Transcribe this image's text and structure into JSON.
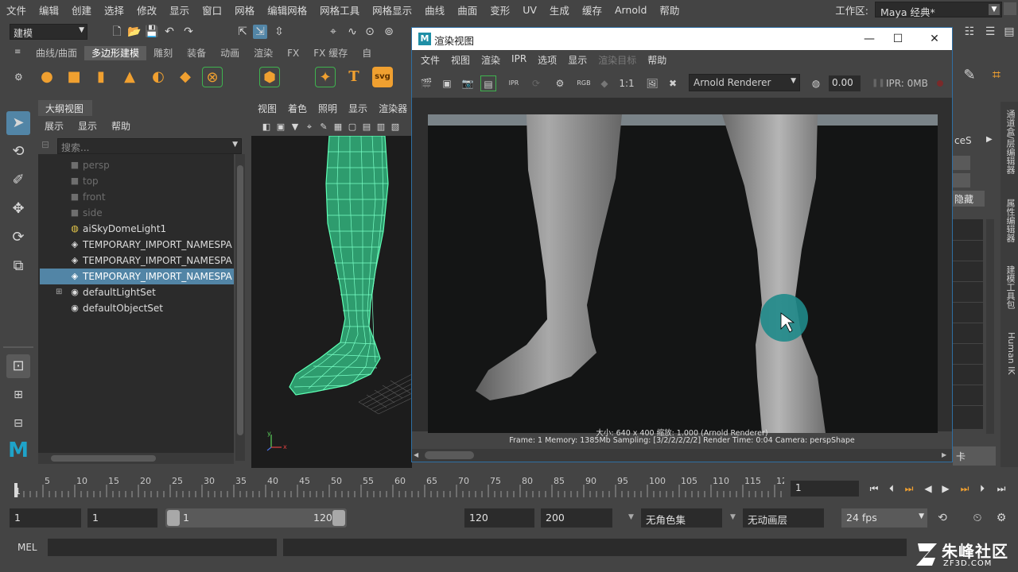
{
  "menubar": {
    "items": [
      "文件",
      "编辑",
      "创建",
      "选择",
      "修改",
      "显示",
      "窗口",
      "网格",
      "编辑网格",
      "网格工具",
      "网格显示",
      "曲线",
      "曲面",
      "变形",
      "UV",
      "生成",
      "缓存",
      "Arnold",
      "帮助"
    ],
    "workspace_label": "工作区:",
    "workspace_value": "Maya 经典*"
  },
  "statusline": {
    "mode": "建模"
  },
  "shelf": {
    "tabs": [
      "曲线/曲面",
      "多边形建模",
      "雕刻",
      "装备",
      "动画",
      "渲染",
      "FX",
      "FX 缓存",
      "自"
    ],
    "active_tab": 1,
    "svg_label": "svg",
    "text_tool_label": "T"
  },
  "outliner": {
    "title": "大纲视图",
    "menu": [
      "展示",
      "显示",
      "帮助"
    ],
    "search_placeholder": "搜索...",
    "items": [
      {
        "label": "persp",
        "icon": "camera-icon",
        "dim": true,
        "sel": false,
        "exp": false
      },
      {
        "label": "top",
        "icon": "camera-icon",
        "dim": true,
        "sel": false,
        "exp": false
      },
      {
        "label": "front",
        "icon": "camera-icon",
        "dim": true,
        "sel": false,
        "exp": false
      },
      {
        "label": "side",
        "icon": "camera-icon",
        "dim": true,
        "sel": false,
        "exp": false
      },
      {
        "label": "aiSkyDomeLight1",
        "icon": "skydome-light-icon",
        "dim": false,
        "sel": false,
        "exp": false
      },
      {
        "label": "TEMPORARY_IMPORT_NAMESPA",
        "icon": "mesh-transform-icon",
        "dim": false,
        "sel": false,
        "exp": false
      },
      {
        "label": "TEMPORARY_IMPORT_NAMESPA",
        "icon": "mesh-transform-icon",
        "dim": false,
        "sel": false,
        "exp": false
      },
      {
        "label": "TEMPORARY_IMPORT_NAMESPA",
        "icon": "mesh-transform-icon",
        "dim": false,
        "sel": true,
        "exp": false
      },
      {
        "label": "defaultLightSet",
        "icon": "set-icon",
        "dim": false,
        "sel": false,
        "exp": true
      },
      {
        "label": "defaultObjectSet",
        "icon": "set-icon",
        "dim": false,
        "sel": false,
        "exp": false
      }
    ]
  },
  "viewport": {
    "menu": [
      "视图",
      "着色",
      "照明",
      "显示",
      "渲染器"
    ],
    "axis_x": "x",
    "axis_y": "y"
  },
  "render_view": {
    "title": "渲染视图",
    "menu": [
      "文件",
      "视图",
      "渲染",
      "IPR",
      "选项",
      "显示",
      "渲染目标",
      "帮助"
    ],
    "disabled_menu_index": 6,
    "ratio_label": "1:1",
    "rgb_label": "RGB",
    "ipr_icon_label": "IPR",
    "renderer": "Arnold Renderer",
    "exposure": "0.00",
    "ipr_memory": "IPR: 0MB",
    "info_line1": "大小: 640 x 400  缩放: 1.000      (Arnold Renderer)",
    "info_line2": "Frame: 1      Memory: 1385Mb      Sampling: [3/2/2/2/2/2]      Render Time: 0:04      Camera: perspShape"
  },
  "right_panel": {
    "partial_label": "ceS",
    "partial_button": "隐藏",
    "partial_bottom": "卡",
    "tabs": [
      "通道盒/层编辑器",
      "属性编辑器",
      "建模工具包",
      "Human IK"
    ]
  },
  "timeslider": {
    "ticks": [
      "5",
      "10",
      "15",
      "20",
      "25",
      "30",
      "35",
      "40",
      "45",
      "50",
      "55",
      "60",
      "65",
      "70",
      "75",
      "80",
      "85",
      "90",
      "95",
      "100",
      "105",
      "110",
      "115",
      "12"
    ],
    "first_tick": "1",
    "current_frame": "1"
  },
  "range": {
    "start": "1",
    "playback_start": "1",
    "range_start": "1",
    "range_end": "120",
    "playback_end": "120",
    "end": "200",
    "character_set": "无角色集",
    "anim_layer": "无动画层",
    "fps": "24 fps"
  },
  "cmdline": {
    "label": "MEL"
  },
  "watermark": {
    "text": "朱峰社区",
    "url": "ZF3D.COM"
  }
}
